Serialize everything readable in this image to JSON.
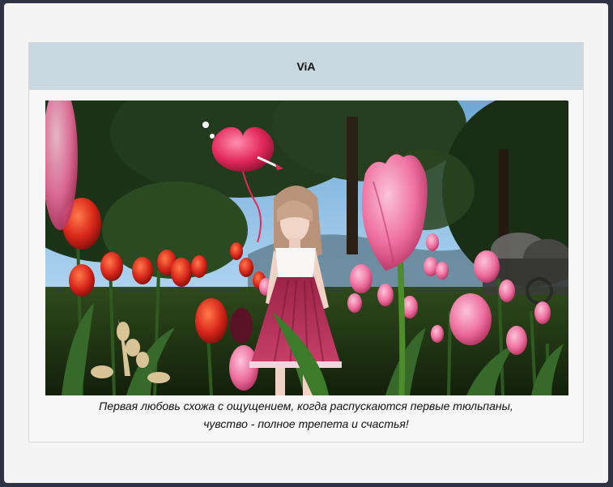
{
  "post": {
    "title": "ViA",
    "caption_lines": [
      "Первая любовь схожа с ощущением, когда распускаются первые тюльпаны,",
      "чувство - полное трепета и счастья!"
    ]
  },
  "colors": {
    "page_bg": "#2f3242",
    "window_bg": "#f4f4f4",
    "header_bg": "#c8d7e0",
    "sky": "#8fc0e6",
    "tulip_red": "#d8261a",
    "tulip_pink": "#ee6f9f",
    "dress": "#b42d55",
    "heart": "#e2295a"
  },
  "icons": {
    "balloon": "heart-balloon-icon"
  }
}
